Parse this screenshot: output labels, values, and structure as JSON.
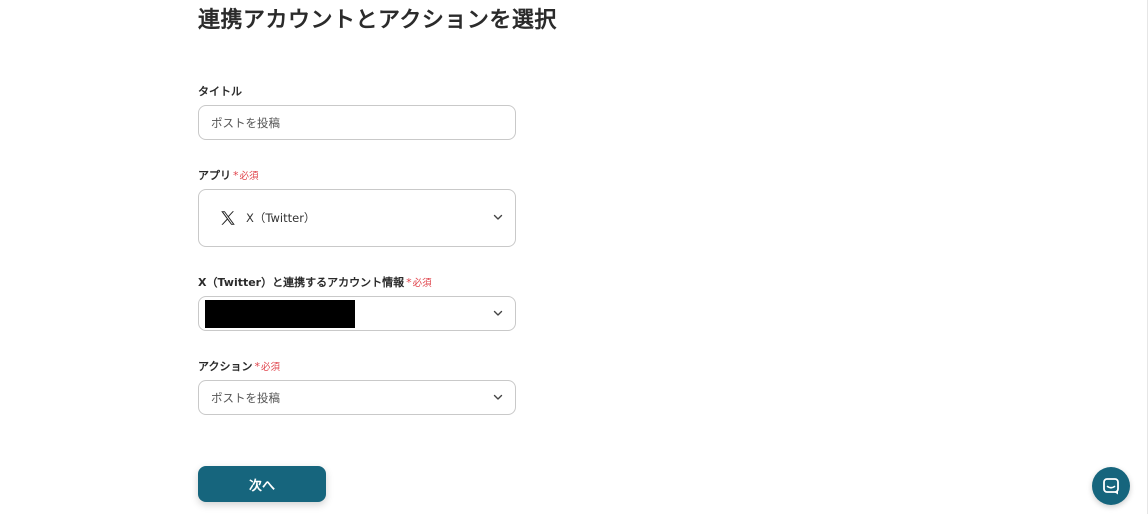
{
  "page": {
    "title": "連携アカウントとアクションを選択"
  },
  "form": {
    "title_field": {
      "label": "タイトル",
      "value": "ポストを投稿"
    },
    "app_field": {
      "label": "アプリ",
      "required_mark": "*",
      "required_text": "必須",
      "value": "X（Twitter）",
      "icon": "x-logo-icon"
    },
    "account_field": {
      "label": "X（Twitter）と連携するアカウント情報",
      "required_mark": "*",
      "required_text": "必須",
      "value_redacted": true
    },
    "action_field": {
      "label": "アクション",
      "required_mark": "*",
      "required_text": "必須",
      "value": "ポストを投稿"
    }
  },
  "buttons": {
    "next_label": "次へ"
  },
  "icons": {
    "dropdown": "chevron-down-icon",
    "chat": "chat-icon"
  },
  "colors": {
    "primary": "#16657d",
    "required": "#e0434b",
    "border": "#c9c9c9"
  }
}
